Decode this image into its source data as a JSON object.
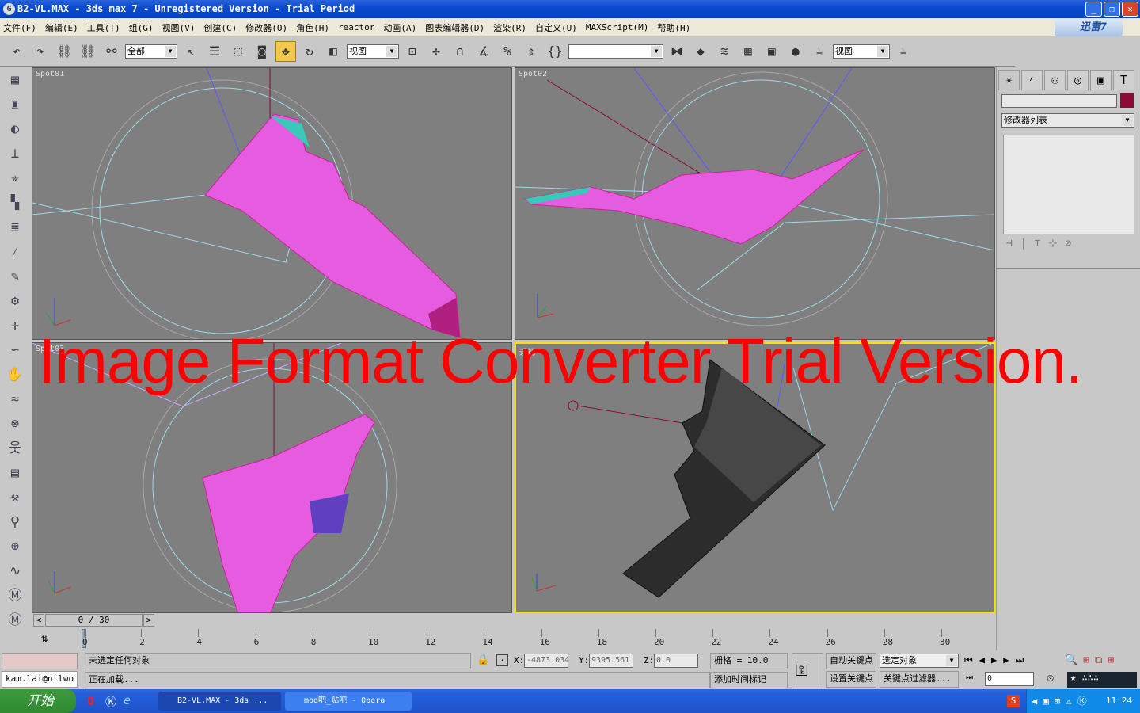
{
  "window": {
    "title": "B2-VL.MAX - 3ds max 7  - Unregistered Version - Trial Period",
    "minimize": "_",
    "maximize": "❐",
    "close": "✕"
  },
  "menu": [
    "文件(F)",
    "编辑(E)",
    "工具(T)",
    "组(G)",
    "视图(V)",
    "创建(C)",
    "修改器(O)",
    "角色(H)",
    "reactor",
    "动画(A)",
    "图表编辑器(D)",
    "渲染(R)",
    "自定义(U)",
    "MAXScript(M)",
    "帮助(H)"
  ],
  "xunlei": "迅雷7",
  "toolbar": {
    "selection_filter": "全部",
    "ref_coord": "视图",
    "named_sel": "",
    "render_view": "视图"
  },
  "viewports": [
    {
      "label": "Spot01"
    },
    {
      "label": "Spot02"
    },
    {
      "label": "Spot03"
    },
    {
      "label": "透视"
    }
  ],
  "watermark": "Image Format Converter Trial Version.",
  "right_panel": {
    "name_field": "",
    "object_color": "#8b0a3a",
    "modifier_list": "修改器列表"
  },
  "time_slider": {
    "value": "0 / 30",
    "prev": "<",
    "next": ">"
  },
  "track_ticks": [
    "0",
    "2",
    "4",
    "6",
    "8",
    "10",
    "12",
    "14",
    "16",
    "18",
    "20",
    "22",
    "24",
    "26",
    "28",
    "30"
  ],
  "status": {
    "maxscript_listener": "",
    "user": "kam.lai@ntlwo",
    "prompt1": "未选定任何对象",
    "prompt2": "正在加载...",
    "x_label": "X:",
    "x": "-4873.034",
    "y_label": "Y:",
    "y": "9395.561",
    "z_label": "Z:",
    "z": "0.0",
    "grid": "栅格 = 10.0",
    "add_time_tag": "添加时间标记",
    "auto_key": "自动关键点",
    "set_key": "设置关键点",
    "key_mode": "选定对象",
    "key_filters": "关键点过滤器...",
    "frame": "0"
  },
  "taskbar": {
    "start": "开始",
    "tasks": [
      "B2-VL.MAX - 3ds ...",
      "mod吧_贴吧 - Opera"
    ],
    "clock": "11:24"
  }
}
